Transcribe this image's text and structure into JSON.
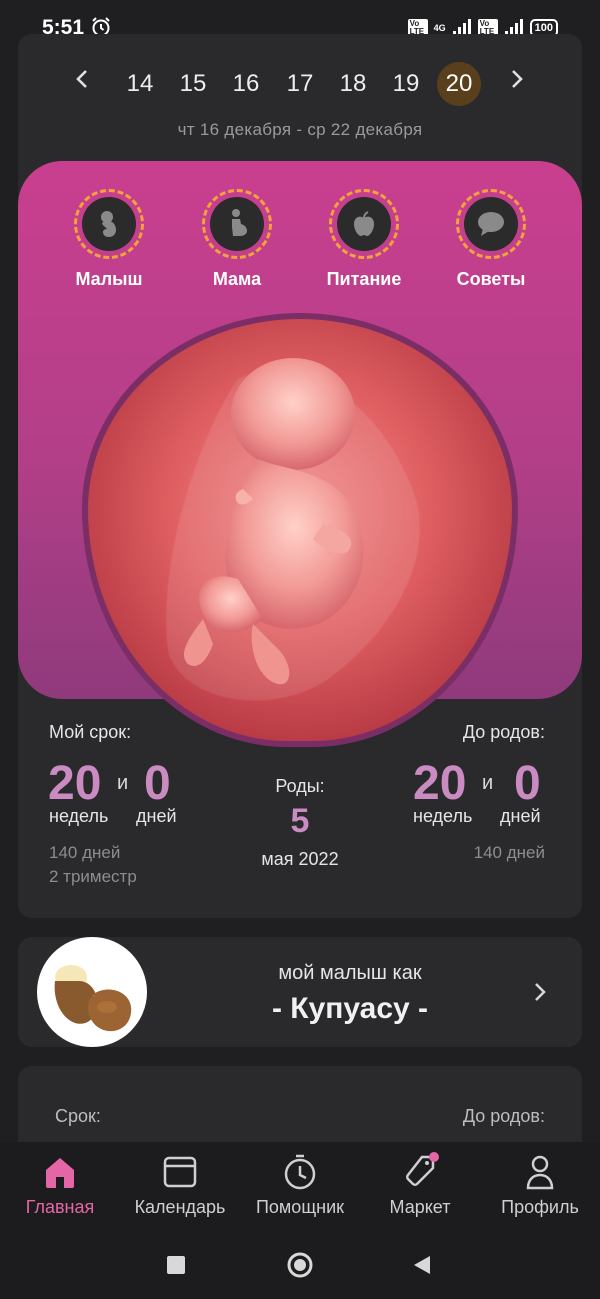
{
  "status": {
    "time": "5:51",
    "battery": "100",
    "network": "4G",
    "volte1": "Vo LTE",
    "volte2": "Vo LTE"
  },
  "week_nav": {
    "weeks": [
      "14",
      "15",
      "16",
      "17",
      "18",
      "19",
      "20"
    ],
    "selected": "20",
    "date_range": "чт 16 декабря - ср 22 декабря"
  },
  "categories": [
    {
      "label": "Малыш",
      "icon": "baby-icon"
    },
    {
      "label": "Мама",
      "icon": "pregnant-woman-icon"
    },
    {
      "label": "Питание",
      "icon": "apple-icon"
    },
    {
      "label": "Советы",
      "icon": "chat-bubble-icon"
    }
  ],
  "term": {
    "label": "Мой срок:",
    "weeks": "20",
    "conj": "и",
    "days": "0",
    "weeks_unit": "недель",
    "days_unit": "дней",
    "total_days": "140 дней",
    "trimester": "2 триместр"
  },
  "birth": {
    "label": "Роды:",
    "day": "5",
    "month_year": "мая 2022"
  },
  "until": {
    "label": "До родов:",
    "weeks": "20",
    "conj": "и",
    "days": "0",
    "weeks_unit": "недель",
    "days_unit": "дней",
    "total_days": "140 дней"
  },
  "fruit": {
    "subtitle": "мой малыш как",
    "name": "- Купуасу -"
  },
  "card3": {
    "left_label": "Срок:",
    "right_label": "До родов:"
  },
  "bottom_nav": [
    {
      "label": "Главная",
      "icon": "home-icon",
      "active": true
    },
    {
      "label": "Календарь",
      "icon": "calendar-icon",
      "active": false
    },
    {
      "label": "Помощник",
      "icon": "clock-icon",
      "active": false
    },
    {
      "label": "Маркет",
      "icon": "tag-icon",
      "active": false
    },
    {
      "label": "Профиль",
      "icon": "person-icon",
      "active": false
    }
  ],
  "colors": {
    "accent_pink": "#e566a6",
    "number_purple": "#c98bc1",
    "panel_pink": "#c93f8f",
    "dash_orange": "#f2a23a"
  }
}
